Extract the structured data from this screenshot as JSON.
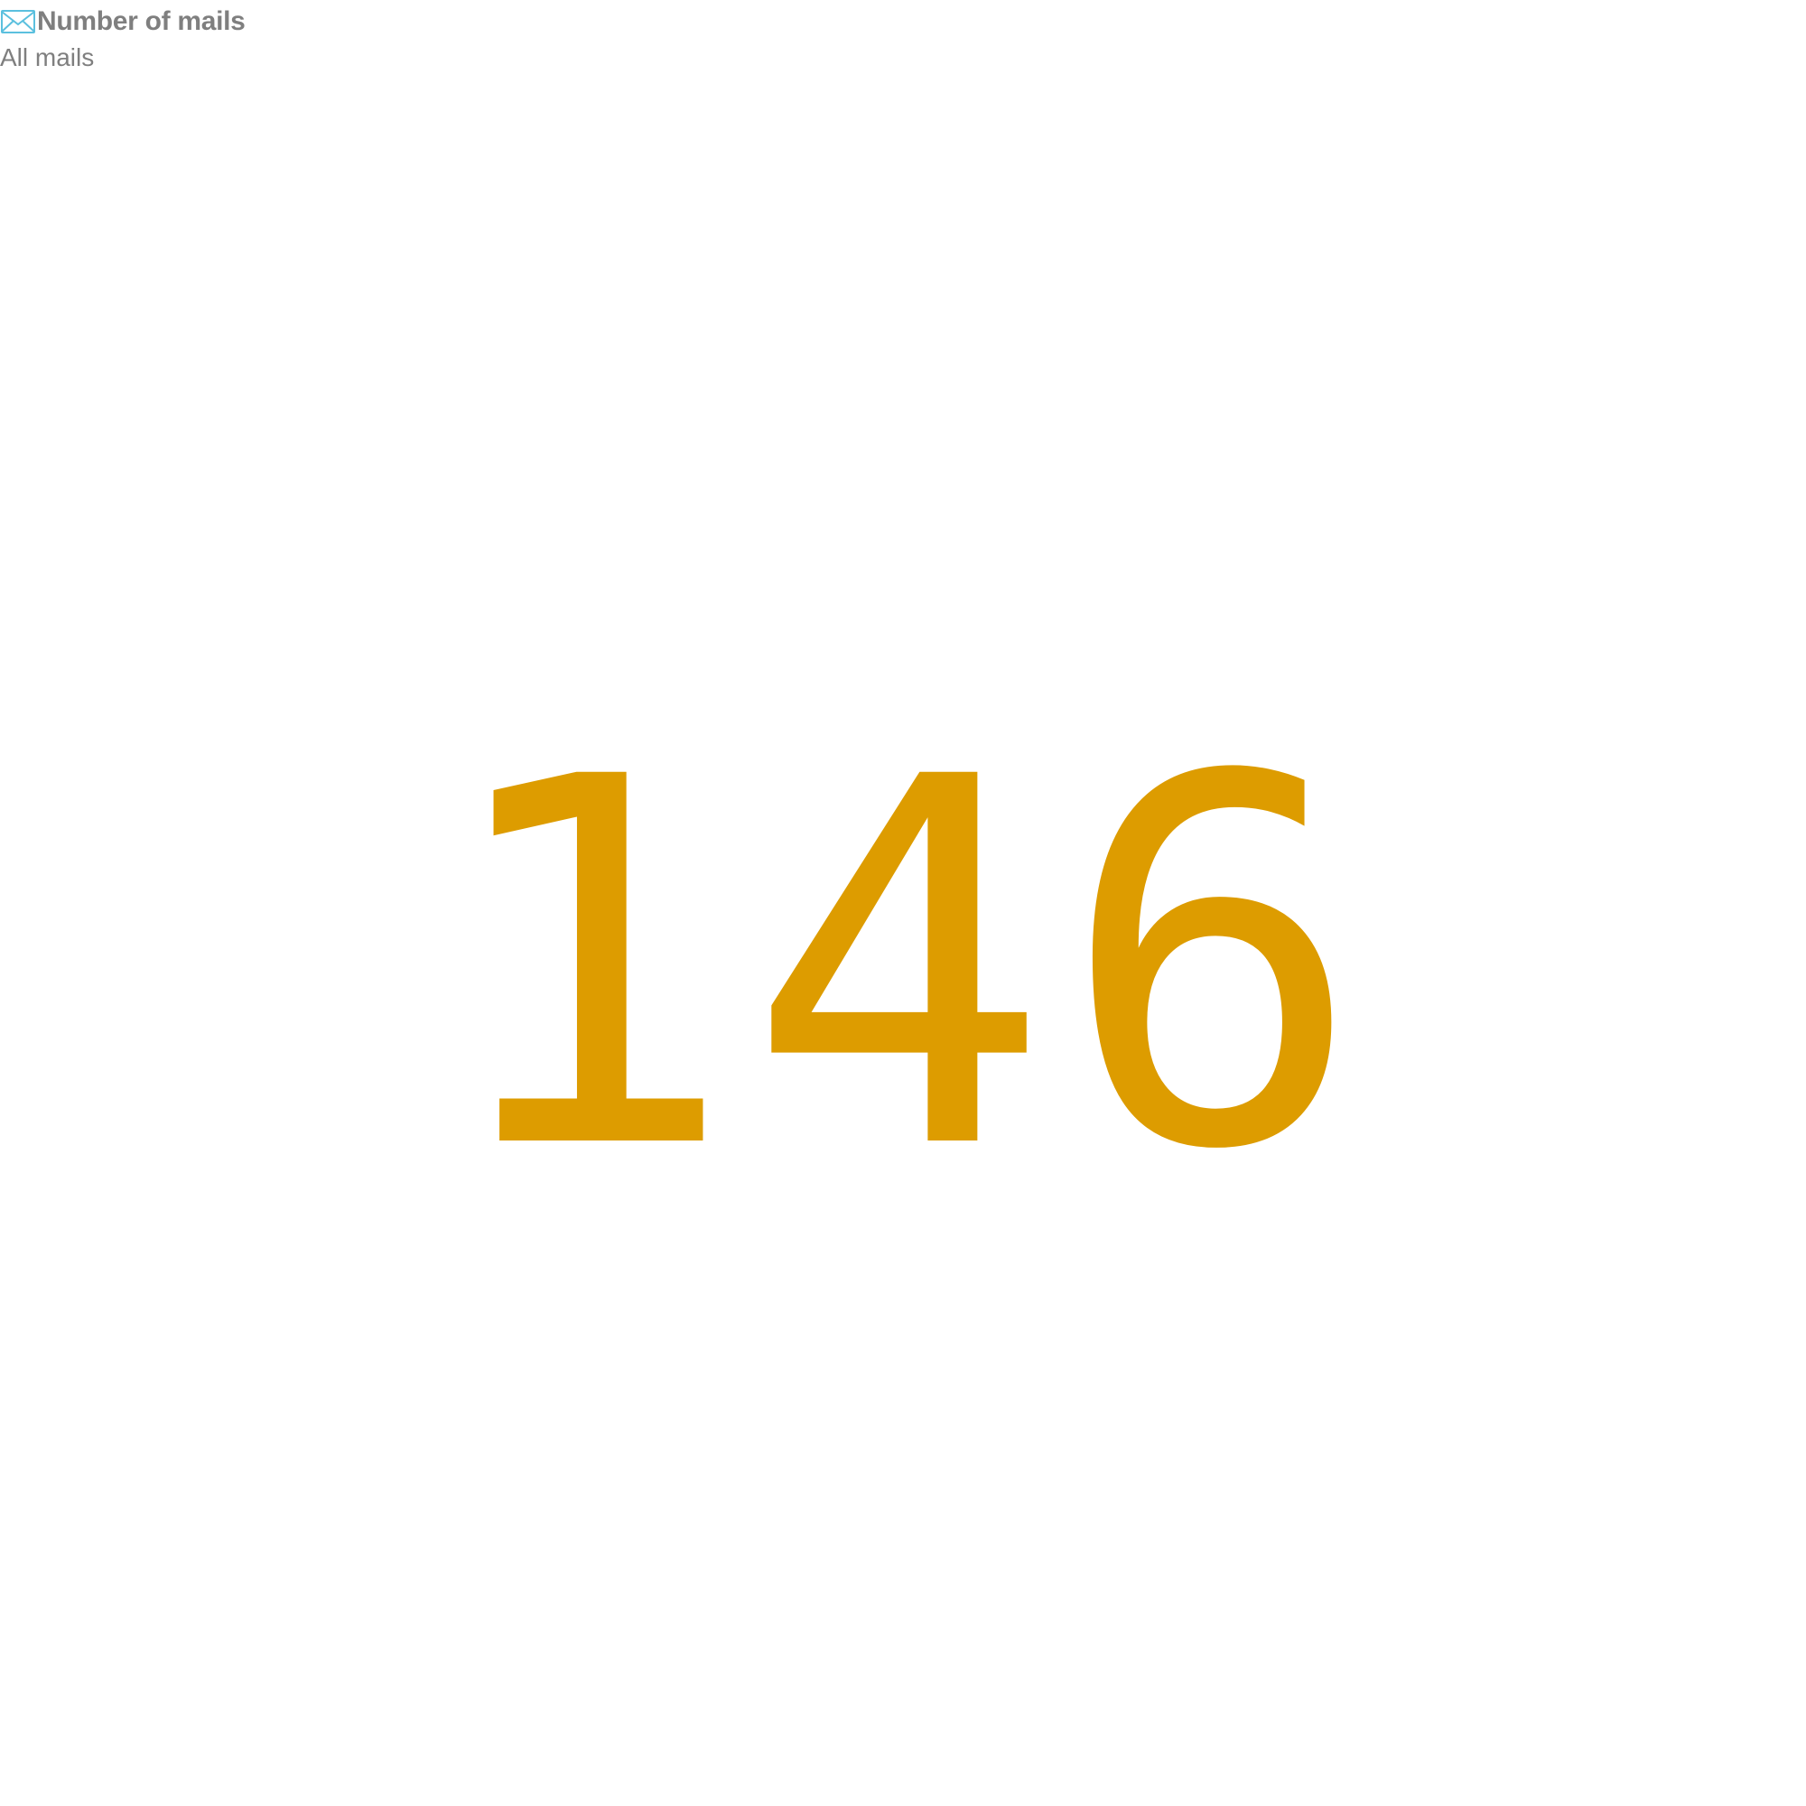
{
  "kpi": {
    "icon": "envelope-icon",
    "title": "Number of mails",
    "subtitle": "All mails",
    "value": "146"
  },
  "colors": {
    "value": "#dd9c00",
    "label": "#7f7f7f",
    "icon": "#5bc0de"
  }
}
